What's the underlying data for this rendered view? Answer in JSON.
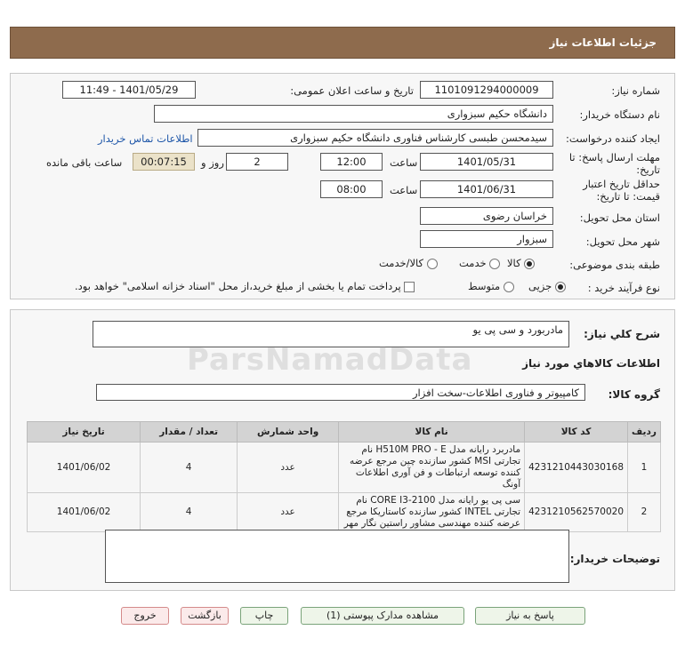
{
  "header": {
    "title": "جزئیات اطلاعات نیاز"
  },
  "form": {
    "need_number_label": "شماره نیاز:",
    "need_number": "1101091294000009",
    "announce_label": "تاریخ و ساعت اعلان عمومی:",
    "announce_value": "1401/05/29 - 11:49",
    "buyer_org_label": "نام دستگاه خریدار:",
    "buyer_org": "دانشگاه حکیم سبزواری",
    "requester_label": "ایجاد کننده درخواست:",
    "requester": "سیدمحسن طبسی کارشناس فناوری دانشگاه حکیم سبزواری",
    "contact_link": "اطلاعات تماس خریدار",
    "reply_deadline_label_1": "مهلت ارسال پاسخ: تا",
    "reply_deadline_label_2": "تاریخ:",
    "reply_date": "1401/05/31",
    "time_label": "ساعت",
    "reply_time": "12:00",
    "days_value": "2",
    "days_label": "روز و",
    "remaining_time": "00:07:15",
    "remaining_label": "ساعت باقی مانده",
    "validity_label_1": "حداقل تاریخ اعتبار",
    "validity_label_2": "قیمت: تا تاریخ:",
    "validity_date": "1401/06/31",
    "validity_time": "08:00",
    "province_label": "استان محل تحویل:",
    "province": "خراسان رضوی",
    "city_label": "شهر محل تحویل:",
    "city": "سبزوار",
    "category_label": "طبقه بندی موضوعی:",
    "category_options": [
      "کالا",
      "خدمت",
      "کالا/خدمت"
    ],
    "purchase_type_label": "نوع فرآیند خرید :",
    "purchase_options": [
      "جزیی",
      "متوسط"
    ],
    "payment_note": "پرداخت تمام یا بخشی از مبلغ خرید،از محل \"اسناد خزانه اسلامی\" خواهد بود."
  },
  "need": {
    "summary_label": "شرح کلي نياز:",
    "summary": "مادربورد و سی پی یو",
    "goods_info_title": "اطلاعات کالاهاي مورد نياز",
    "goods_group_label": "گروه کالا:",
    "goods_group": "کامپیوتر و فناوری اطلاعات-سخت افزار"
  },
  "table": {
    "headers": [
      "ردیف",
      "کد کالا",
      "نام کالا",
      "واحد شمارش",
      "تعداد / مقدار",
      "تاریخ نیاز"
    ],
    "rows": [
      {
        "row": "1",
        "code": "4231210443030168",
        "name": "مادربرد رایانه مدل H510M PRO - E نام تجارتی MSI کشور سازنده چین مرجع عرضه کننده توسعه ارتباطات و فن آوری اطلاعات آونگ",
        "unit": "عدد",
        "qty": "4",
        "date": "1401/06/02"
      },
      {
        "row": "2",
        "code": "4231210562570020",
        "name": "سی پی یو رایانه مدل CORE I3-2100 نام تجارتی INTEL کشور سازنده کاستاریکا مرجع عرضه کننده مهندسی مشاور راستین نگار مهر",
        "unit": "عدد",
        "qty": "4",
        "date": "1401/06/02"
      }
    ]
  },
  "buyer_notes_label": "توضیحات خریدار:",
  "buyer_notes": "",
  "buttons": {
    "reply": "پاسخ به نیاز",
    "attachments": "مشاهده مدارک پیوستی (1)",
    "print": "چاپ",
    "back": "بازگشت",
    "exit": "خروج"
  },
  "watermark": "ParsNamadData"
}
